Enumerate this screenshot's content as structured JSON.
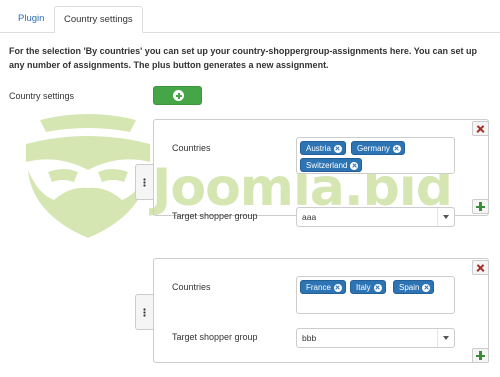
{
  "tabs": [
    {
      "label": "Plugin"
    },
    {
      "label": "Country settings",
      "active": true
    }
  ],
  "description": "For the selection 'By countries' you can set up your country-shoppergroup-assignments here. You can set up any number of assignments. The plus button generates a new assignment.",
  "country_settings": {
    "label": "Country settings",
    "add_icon": "plus-circle-icon"
  },
  "watermark": {
    "text": "Joomla.bid"
  },
  "assignments": [
    {
      "countries_label": "Countries",
      "countries": [
        "Austria",
        "Germany",
        "Switzerland"
      ],
      "target_label": "Target shopper group",
      "target_value": "aaa"
    },
    {
      "countries_label": "Countries",
      "countries": [
        "France",
        "Italy",
        "Spain"
      ],
      "target_label": "Target shopper group",
      "target_value": "bbb"
    }
  ],
  "icons": {
    "remove": "remove-icon",
    "add": "plus-icon",
    "drag": "drag-handle-icon",
    "chip_remove": "remove-chip-icon",
    "dropdown": "chevron-down-icon"
  },
  "colors": {
    "link": "#2a6ebb",
    "success": "#46a546",
    "chip": "#2d74b4",
    "danger": "#a3312a",
    "watermark": "#bcd682"
  }
}
